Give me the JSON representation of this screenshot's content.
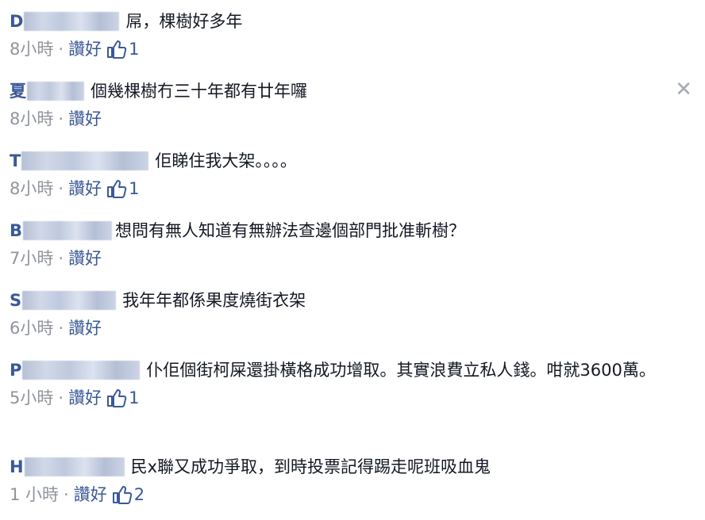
{
  "comments": [
    {
      "initial": "D",
      "text": "屌，棵樹好多年",
      "time": "8小時",
      "like_label": "讚好",
      "likes": "1"
    },
    {
      "initial": "夏",
      "text": "個幾棵樹冇三十年都有廿年囉",
      "time": "8小時",
      "like_label": "讚好",
      "likes": ""
    },
    {
      "initial": "T",
      "text": "佢睇住我大架。。。。",
      "time": "8小時",
      "like_label": "讚好",
      "likes": "1"
    },
    {
      "initial": "B",
      "text": "想問有無人知道有無辦法查邊個部門批准斬樹？",
      "time": "7小時",
      "like_label": "讚好",
      "likes": ""
    },
    {
      "initial": "S",
      "text": "我年年都係果度燒街衣架",
      "time": "6小時",
      "like_label": "讚好",
      "likes": ""
    },
    {
      "initial": "P",
      "text": "仆佢個街柯屎還掛橫格成功增取。其實浪費立私人錢。咁就3600萬。",
      "time": "5小時",
      "like_label": "讚好",
      "likes": "1"
    },
    {
      "initial": "H",
      "text": "民x聯又成功爭取，到時投票記得踢走呢班吸血鬼",
      "time": "1 小時",
      "like_label": "讚好",
      "likes": "2"
    }
  ],
  "dot": "·",
  "close_glyph": "✕",
  "icons": {
    "like": "thumbs-up-icon",
    "close": "close-icon"
  }
}
